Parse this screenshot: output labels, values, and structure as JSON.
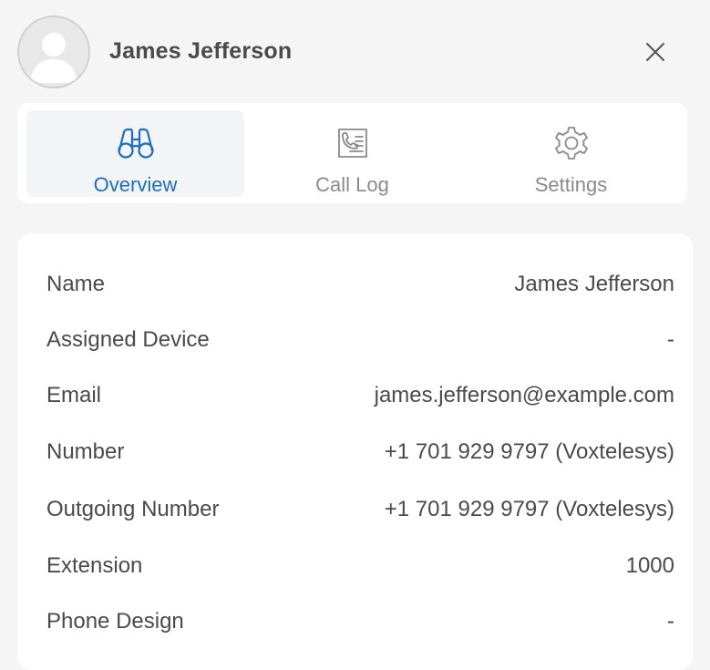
{
  "header": {
    "user_name": "James Jefferson"
  },
  "icons": {
    "avatar": "user-avatar-icon",
    "close": "close-icon",
    "overview": "binoculars-icon",
    "call_log": "call-log-icon",
    "settings": "gear-icon"
  },
  "colors": {
    "accent": "#1c6dc6",
    "tab_inactive": "#8a8a8a"
  },
  "tabs": [
    {
      "label": "Overview",
      "active": true
    },
    {
      "label": "Call Log",
      "active": false
    },
    {
      "label": "Settings",
      "active": false
    }
  ],
  "details": [
    {
      "label": "Name",
      "value": "James Jefferson"
    },
    {
      "label": "Assigned Device",
      "value": "-"
    },
    {
      "label": "Email",
      "value": "james.jefferson@example.com"
    },
    {
      "label": "Number",
      "value": "+1 701 929 9797 (Voxtelesys)"
    },
    {
      "label": "Outgoing Number",
      "value": "+1 701 929 9797 (Voxtelesys)"
    },
    {
      "label": "Extension",
      "value": "1000"
    },
    {
      "label": "Phone Design",
      "value": "-"
    }
  ]
}
